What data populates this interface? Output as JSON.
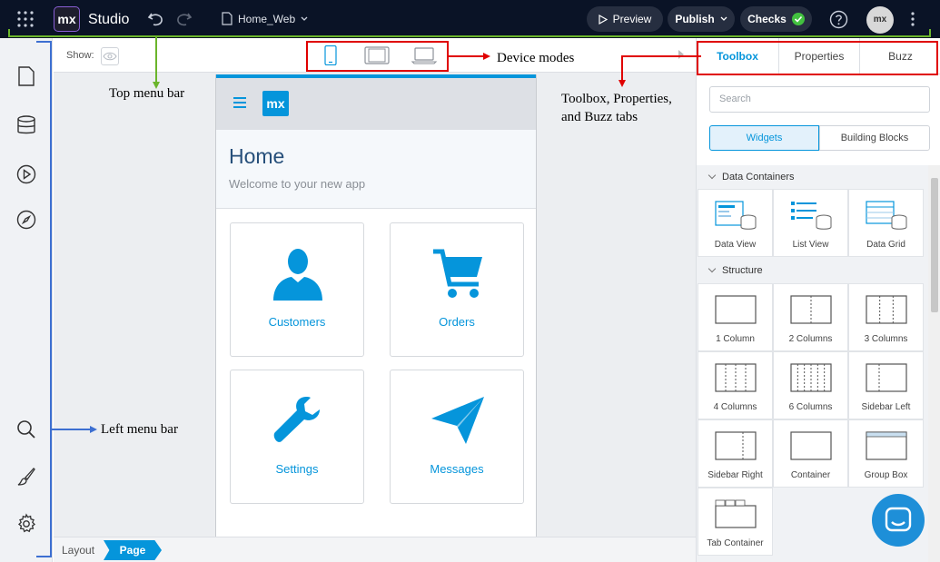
{
  "topbar": {
    "logo": "mx",
    "app_title": "Studio",
    "document": "Home_Web",
    "preview_label": "Preview",
    "publish_label": "Publish",
    "checks_label": "Checks",
    "avatar_initials": "mx"
  },
  "canvas": {
    "show_label": "Show:"
  },
  "phone": {
    "logo": "mx",
    "title": "Home",
    "subtitle": "Welcome to your new app",
    "tiles": [
      {
        "label": "Customers",
        "icon": "user-icon"
      },
      {
        "label": "Orders",
        "icon": "cart-icon"
      },
      {
        "label": "Settings",
        "icon": "wrench-icon"
      },
      {
        "label": "Messages",
        "icon": "paper-plane-icon"
      }
    ]
  },
  "status": {
    "layout_label": "Layout",
    "page_label": "Page"
  },
  "panel": {
    "tabs": [
      "Toolbox",
      "Properties",
      "Buzz"
    ],
    "search_placeholder": "Search",
    "segments": [
      "Widgets",
      "Building Blocks"
    ],
    "sections": [
      {
        "title": "Data Containers",
        "items": [
          "Data View",
          "List View",
          "Data Grid"
        ]
      },
      {
        "title": "Structure",
        "items": [
          "1 Column",
          "2 Columns",
          "3 Columns",
          "4 Columns",
          "6 Columns",
          "Sidebar Left",
          "Sidebar Right",
          "Container",
          "Group Box",
          "Tab Container"
        ]
      }
    ]
  },
  "annotations": {
    "top_menu_bar": "Top menu bar",
    "left_menu_bar": "Left menu bar",
    "device_modes": "Device modes",
    "tabs_line1": "Toolbox, Properties,",
    "tabs_line2": "and Buzz tabs"
  },
  "colors": {
    "topbar_bg": "#0a1326",
    "accent_blue": "#0595db",
    "check_green": "#42c13f",
    "annotation_red": "#e00000",
    "annotation_green": "#6bb52c",
    "annotation_blue": "#3d6fd1"
  }
}
